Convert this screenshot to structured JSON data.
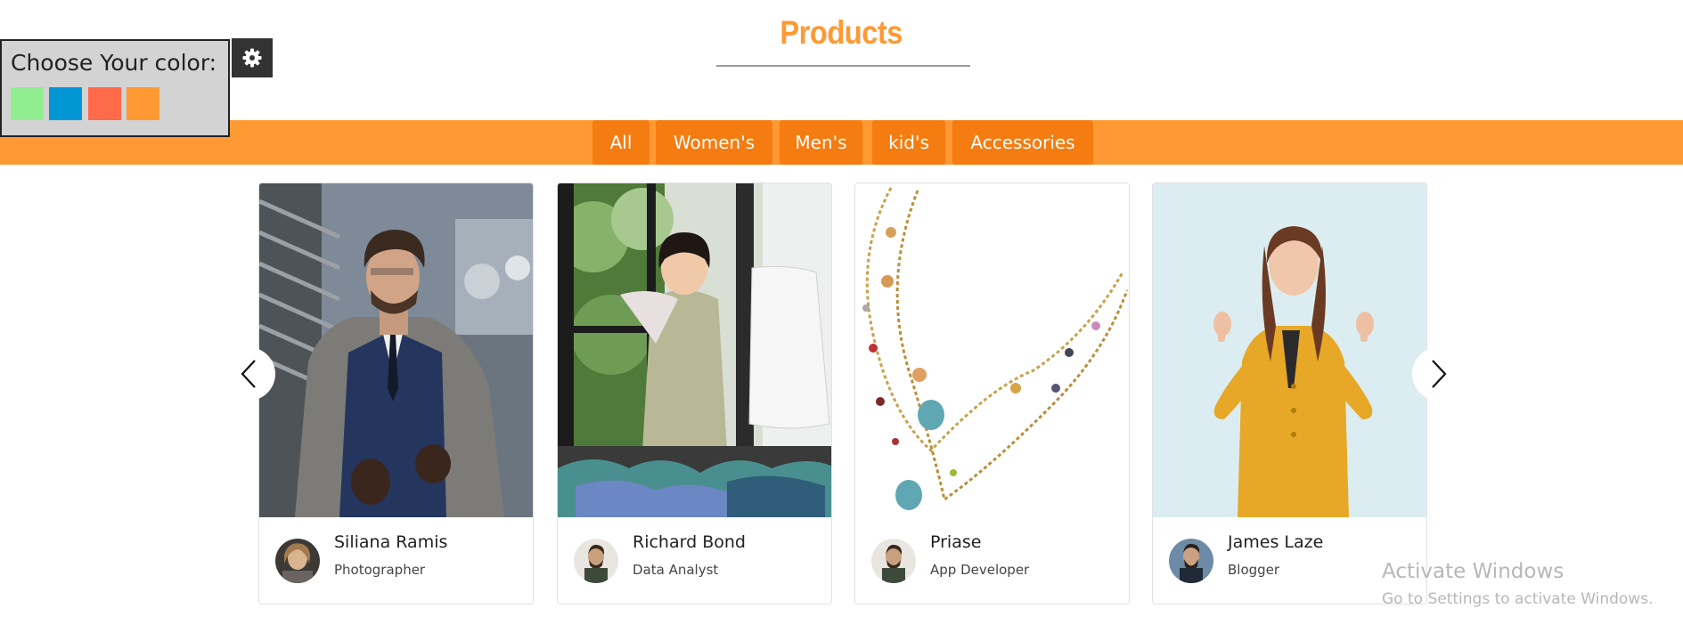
{
  "header": {
    "title": "Products"
  },
  "color_picker": {
    "label": "Choose Your color:",
    "swatches": [
      {
        "name": "green",
        "color": "#90ee90"
      },
      {
        "name": "blue",
        "color": "#0396d5"
      },
      {
        "name": "tomato",
        "color": "#ff6a4b"
      },
      {
        "name": "orange",
        "color": "#ff9933"
      }
    ],
    "toggle_icon": "gear-icon"
  },
  "filters": {
    "items": [
      "All",
      "Women's",
      "Men's",
      "kid's",
      "Accessories"
    ],
    "bar_color": "#ff9933",
    "button_color": "#f57c10"
  },
  "carousel": {
    "prev_icon": "chevron-left-icon",
    "next_icon": "chevron-right-icon",
    "cards": [
      {
        "name": "Siliana Ramis",
        "role": "Photographer",
        "image": "man-in-suit-photo"
      },
      {
        "name": "Richard Bond",
        "role": "Data Analyst",
        "image": "girl-with-clothes-photo"
      },
      {
        "name": "Priase",
        "role": "App Developer",
        "image": "necklace-photo"
      },
      {
        "name": "James Laze",
        "role": "Blogger",
        "image": "woman-yellow-suit-photo"
      }
    ]
  },
  "watermark": {
    "title": "Activate Windows",
    "subtitle": "Go to Settings to activate Windows."
  }
}
